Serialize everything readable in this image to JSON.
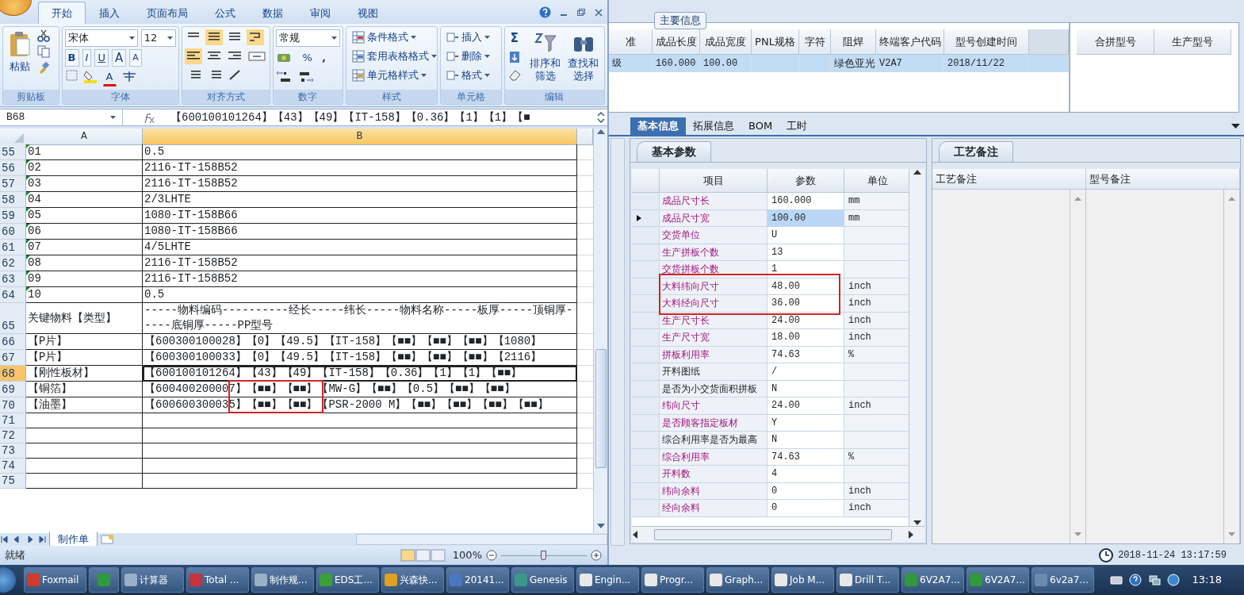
{
  "excel": {
    "tabs": [
      {
        "label": "开始",
        "selected": true
      },
      {
        "label": "插入",
        "selected": false
      },
      {
        "label": "页面布局",
        "selected": false
      },
      {
        "label": "公式",
        "selected": false
      },
      {
        "label": "数据",
        "selected": false
      },
      {
        "label": "审阅",
        "selected": false
      },
      {
        "label": "视图",
        "selected": false
      }
    ],
    "ribbon": {
      "clipboard": {
        "label": "剪贴板",
        "paste": "粘贴"
      },
      "font": {
        "label": "字体",
        "face": "宋体",
        "size": "12",
        "bold": "B",
        "italic": "I",
        "underline": "U",
        "grow": "A",
        "shrink": "A",
        "color_letter": "A"
      },
      "alignment": {
        "label": "对齐方式"
      },
      "number": {
        "label": "数字",
        "format": "常规",
        "percent": "%",
        "comma": ","
      },
      "styles": {
        "label": "样式",
        "items": [
          "条件格式",
          "套用表格格式",
          "单元格样式"
        ]
      },
      "cells": {
        "label": "单元格",
        "items": [
          "插入",
          "删除",
          "格式"
        ]
      },
      "editing": {
        "label": "编辑",
        "sum": "Σ",
        "sort": "排序和筛选",
        "find": "查找和选择"
      }
    },
    "name_box": "B68",
    "formula": "【600100101264】【43】【49】【IT-158】【0.36】【1】【1】【■",
    "columns": [
      "A",
      "B"
    ],
    "rows": [
      {
        "num": "55",
        "a": "01",
        "b": "0.5",
        "flag": true,
        "selected": false
      },
      {
        "num": "56",
        "a": "02",
        "b": "2116-IT-158B52",
        "flag": true,
        "selected": false
      },
      {
        "num": "57",
        "a": "03",
        "b": "2116-IT-158B52",
        "flag": true,
        "selected": false
      },
      {
        "num": "58",
        "a": "04",
        "b": "2/3LHTE",
        "flag": true,
        "selected": false
      },
      {
        "num": "59",
        "a": "05",
        "b": "1080-IT-158B66",
        "flag": true,
        "selected": false
      },
      {
        "num": "60",
        "a": "06",
        "b": "1080-IT-158B66",
        "flag": true,
        "selected": false
      },
      {
        "num": "61",
        "a": "07",
        "b": "4/5LHTE",
        "flag": true,
        "selected": false
      },
      {
        "num": "62",
        "a": "08",
        "b": "2116-IT-158B52",
        "flag": true,
        "selected": false
      },
      {
        "num": "63",
        "a": "09",
        "b": "2116-IT-158B52",
        "flag": true,
        "selected": false
      },
      {
        "num": "64",
        "a": "10",
        "b": "0.5",
        "flag": true,
        "selected": false
      },
      {
        "num": "65",
        "a": "关键物料【类型】",
        "b": "-----物料编码----------经长-----纬长-----物料名称-----板厚-----顶铜厚-----底铜厚-----PP型号",
        "flag": false,
        "selected": false
      },
      {
        "num": "66",
        "a": "【P片】",
        "b": "【600300100028】【0】【49.5】【IT-158】【■■】【■■】【■■】【1080】",
        "flag": false,
        "selected": false
      },
      {
        "num": "67",
        "a": "【P片】",
        "b": "【600300100033】【0】【49.5】【IT-158】【■■】【■■】【■■】【2116】",
        "flag": false,
        "selected": false
      },
      {
        "num": "68",
        "a": "【刚性板材】",
        "b": "【600100101264】【43】【49】【IT-158】【0.36】【1】【1】【■■】",
        "flag": false,
        "selected": true
      },
      {
        "num": "69",
        "a": "【铜箔】",
        "b": "【600400200007】【■■】【■■】【MW-G】【■■】【0.5】【■■】【■■】",
        "flag": false,
        "selected": false
      },
      {
        "num": "70",
        "a": "【油墨】",
        "b": "【600600300035】【■■】【■■】【PSR-2000 M】【■■】【■■】【■■】【■■】",
        "flag": false,
        "selected": false
      },
      {
        "num": "71",
        "flag": false,
        "selected": false
      },
      {
        "num": "72",
        "flag": false,
        "selected": false
      },
      {
        "num": "73",
        "flag": false,
        "selected": false
      },
      {
        "num": "74",
        "flag": false,
        "selected": false
      },
      {
        "num": "75",
        "flag": false,
        "selected": false
      }
    ],
    "sheet_tab": "制作单",
    "status": "就绪",
    "zoom": "100%",
    "zoom_slider": {
      "level": 0.5
    }
  },
  "app": {
    "section_title": "主要信息",
    "main_columns": [
      "准",
      "成品长度",
      "成品宽度",
      "PNL规格",
      "字符",
      "阻焊",
      "终端客户代码",
      "型号创建时间"
    ],
    "main_rows": [
      {
        "selected": true,
        "cells": [
          "级",
          "160.000",
          "100.00",
          null,
          null,
          "绿色亚光",
          "V2A7",
          "2018/11/22"
        ]
      }
    ],
    "merge_columns": [
      "合拼型号",
      "生产型号"
    ],
    "detail_tabs": [
      {
        "label": "基本信息",
        "selected": true
      },
      {
        "label": "拓展信息",
        "selected": false
      },
      {
        "label": "BOM",
        "selected": false
      },
      {
        "label": "工时",
        "selected": false
      }
    ],
    "params_tab": "基本参数",
    "params_columns": [
      "项目",
      "参数",
      "单位"
    ],
    "params_rows": [
      {
        "item": "成品尺寸长",
        "value": "160.000",
        "unit": "mm",
        "emphasized": true,
        "current": false
      },
      {
        "item": "成品尺寸宽",
        "value": "100.00",
        "unit": "mm",
        "emphasized": true,
        "current": true
      },
      {
        "item": "交货单位",
        "value": "U",
        "emphasized": true,
        "current": false
      },
      {
        "item": "生产拼板个数",
        "value": "13",
        "emphasized": true,
        "current": false
      },
      {
        "item": "交货拼板个数",
        "value": "1",
        "emphasized": true,
        "current": false
      },
      {
        "item": "大料纬向尺寸",
        "value": "48.00",
        "unit": "inch",
        "emphasized": true,
        "current": false
      },
      {
        "item": "大料经向尺寸",
        "value": "36.00",
        "unit": "inch",
        "emphasized": true,
        "current": false
      },
      {
        "item": "生产尺寸长",
        "value": "24.00",
        "unit": "inch",
        "emphasized": true,
        "current": false
      },
      {
        "item": "生产尺寸宽",
        "value": "18.00",
        "unit": "inch",
        "emphasized": true,
        "current": false
      },
      {
        "item": "拼板利用率",
        "value": "74.63",
        "unit": "%",
        "emphasized": true,
        "current": false
      },
      {
        "item": "开料图纸",
        "value": "/",
        "emphasized": false,
        "current": false
      },
      {
        "item": "是否为小交货面积拼板",
        "value": "N",
        "emphasized": false,
        "current": false
      },
      {
        "item": "纬向尺寸",
        "value": "24.00",
        "unit": "inch",
        "emphasized": true,
        "current": false
      },
      {
        "item": "是否顾客指定板材",
        "value": "Y",
        "emphasized": true,
        "current": false
      },
      {
        "item": "综合利用率是否为最高",
        "value": "N",
        "emphasized": false,
        "current": false
      },
      {
        "item": "综合利用率",
        "value": "74.63",
        "unit": "%",
        "emphasized": true,
        "current": false
      },
      {
        "item": "开料数",
        "value": "4",
        "emphasized": true,
        "current": false
      },
      {
        "item": "纬向余料",
        "value": "0",
        "unit": "inch",
        "emphasized": true,
        "current": false
      },
      {
        "item": "经向余料",
        "value": "0",
        "unit": "inch",
        "emphasized": true,
        "current": false
      }
    ],
    "notes_tab": "工艺备注",
    "notes_columns": [
      "工艺备注",
      "型号备注"
    ],
    "clock": "2018-11-24 13:17:59"
  },
  "taskbar": {
    "items": [
      {
        "kind": "app",
        "label": "Foxmail"
      },
      {
        "kind": "icon"
      },
      {
        "kind": "app",
        "label": "计算器"
      },
      {
        "kind": "app",
        "label": "Total ..."
      },
      {
        "kind": "app",
        "label": "制作规..."
      },
      {
        "kind": "app",
        "label": "EDS工..."
      },
      {
        "kind": "app",
        "label": "兴森快..."
      },
      {
        "kind": "app",
        "label": "20141..."
      },
      {
        "kind": "app",
        "label": "Genesis"
      },
      {
        "kind": "app",
        "label": "Engin..."
      },
      {
        "kind": "app",
        "label": "Progr..."
      },
      {
        "kind": "app",
        "label": "Graph..."
      },
      {
        "kind": "app",
        "label": "Job M..."
      },
      {
        "kind": "app",
        "label": "Drill T..."
      },
      {
        "kind": "app",
        "label": "6V2A7..."
      },
      {
        "kind": "app",
        "label": "6V2A7..."
      },
      {
        "kind": "app",
        "label": "6v2a7..."
      }
    ],
    "time": "13:18"
  }
}
